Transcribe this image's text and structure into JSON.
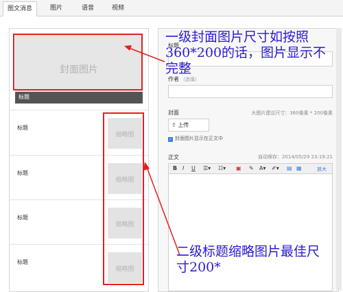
{
  "tabs": [
    {
      "label": "图文消息",
      "active": true
    },
    {
      "label": "图片",
      "active": false
    },
    {
      "label": "语音",
      "active": false
    },
    {
      "label": "视频",
      "active": false
    }
  ],
  "left_panel": {
    "cover_placeholder": "封面图片",
    "cover_title": "标题",
    "items": [
      {
        "title": "标题",
        "thumb": "缩略图"
      },
      {
        "title": "标题",
        "thumb": "缩略图"
      },
      {
        "title": "标题",
        "thumb": "缩略图"
      },
      {
        "title": "标题",
        "thumb": "缩略图"
      }
    ]
  },
  "form": {
    "title_label": "标题",
    "author_label": "作者",
    "author_optional": "（选填）",
    "cover_label": "封面",
    "cover_hint": "大图片建议尺寸：360像素 * 200像素",
    "upload_label": "上传",
    "show_cover_label": "封面图片显示在正文中",
    "body_label": "正文",
    "autosave": "自动保存：2014/05/29 23:19:21",
    "toolbar": {
      "bold": "B",
      "italic": "I",
      "underline": "U",
      "fontcolor": "A",
      "enlarge": "放大"
    }
  },
  "annotations": {
    "top": "一级封面图片尺寸如按照360*200的话，图片显示不完整",
    "bottom": "二级标题缩略图片最佳尺寸200*"
  },
  "colors": {
    "annotation_text": "#2a1bd0",
    "annotation_box": "#e02020",
    "check_blue": "#3b7be0"
  }
}
